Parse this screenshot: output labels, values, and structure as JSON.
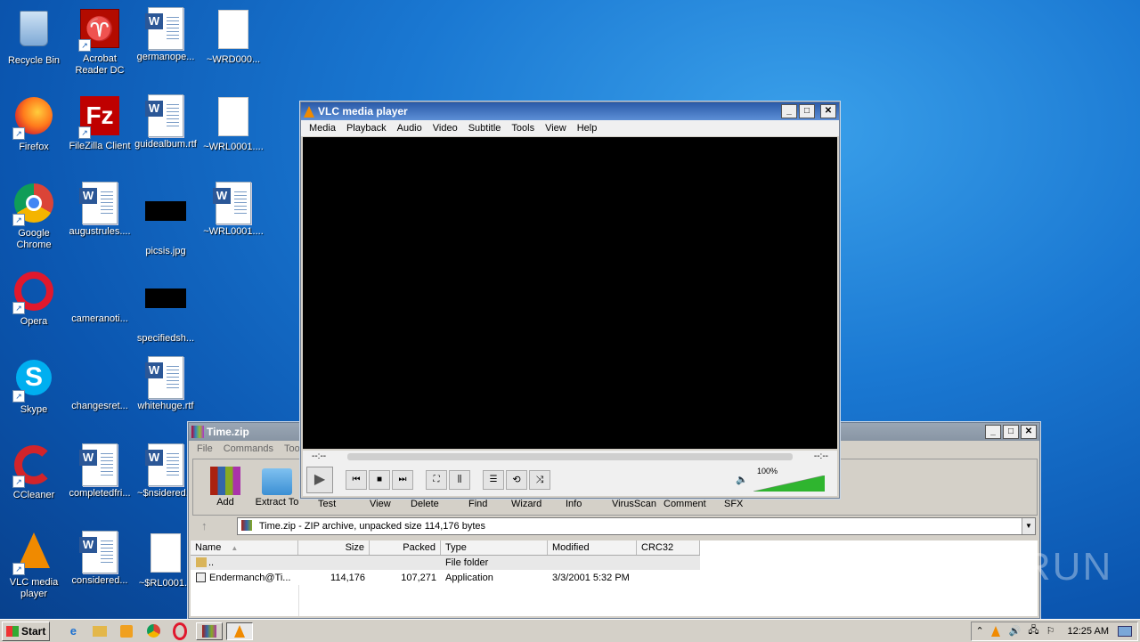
{
  "desktop": {
    "icons": [
      {
        "label": "Recycle Bin"
      },
      {
        "label": "Acrobat Reader DC"
      },
      {
        "label": "germanope..."
      },
      {
        "label": "~WRD000..."
      },
      {
        "label": "Firefox"
      },
      {
        "label": "FileZilla Client"
      },
      {
        "label": "guidealbum.rtf"
      },
      {
        "label": "~WRL0001...."
      },
      {
        "label": "Google Chrome"
      },
      {
        "label": "augustrules...."
      },
      {
        "label": "picsis.jpg"
      },
      {
        "label": "~WRL0001...."
      },
      {
        "label": "Opera"
      },
      {
        "label": "cameranoti..."
      },
      {
        "label": "specifiedsh..."
      },
      {
        "label": "Skype"
      },
      {
        "label": "changesret..."
      },
      {
        "label": "whitehuge.rtf"
      },
      {
        "label": "CCleaner"
      },
      {
        "label": "completedfri..."
      },
      {
        "label": "~$nsidered..."
      },
      {
        "label": "VLC media player"
      },
      {
        "label": "considered..."
      },
      {
        "label": "~$RL0001..."
      }
    ]
  },
  "vlc": {
    "title": "VLC media player",
    "menu": [
      "Media",
      "Playback",
      "Audio",
      "Video",
      "Subtitle",
      "Tools",
      "View",
      "Help"
    ],
    "time_left": "--:--",
    "time_right": "--:--",
    "volume": "100%",
    "volume_level": 1.0
  },
  "winrar": {
    "title": "Time.zip",
    "menu": [
      "File",
      "Commands",
      "Tools"
    ],
    "toolbar": [
      "Add",
      "Extract To",
      "Test",
      "View",
      "Delete",
      "Find",
      "Wizard",
      "Info",
      "VirusScan",
      "Comment",
      "SFX"
    ],
    "path": "Time.zip - ZIP archive, unpacked size 114,176 bytes",
    "columns": [
      "Name",
      "Size",
      "Packed",
      "Type",
      "Modified",
      "CRC32"
    ],
    "rows": [
      {
        "name": "..",
        "size": "",
        "packed": "",
        "type": "File folder",
        "modified": "",
        "crc": ""
      },
      {
        "name": "Endermanch@Ti...",
        "size": "114,176",
        "packed": "107,271",
        "type": "Application",
        "modified": "3/3/2001 5:32 PM",
        "crc": ""
      }
    ]
  },
  "taskbar": {
    "start": "Start",
    "clock": "12:25 AM"
  },
  "watermark": "ANY RUN"
}
